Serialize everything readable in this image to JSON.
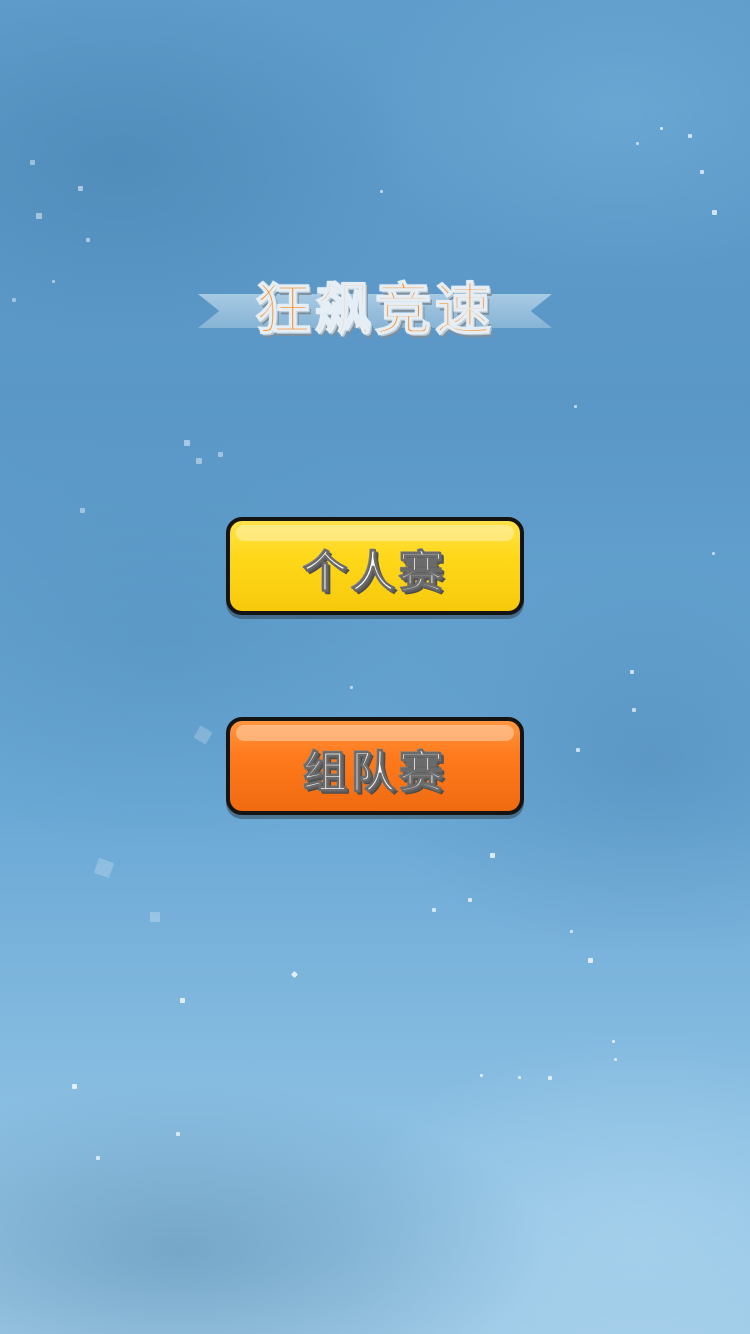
{
  "game": {
    "title": "狂飙竞速"
  },
  "menu": {
    "individual_label": "个人赛",
    "team_label": "组队赛"
  },
  "colors": {
    "background": "#6aa8d5",
    "title_text": "#ff8a1e",
    "individual_button": "#ffd81a",
    "team_button": "#ff7a1c",
    "button_border": "#141414"
  }
}
